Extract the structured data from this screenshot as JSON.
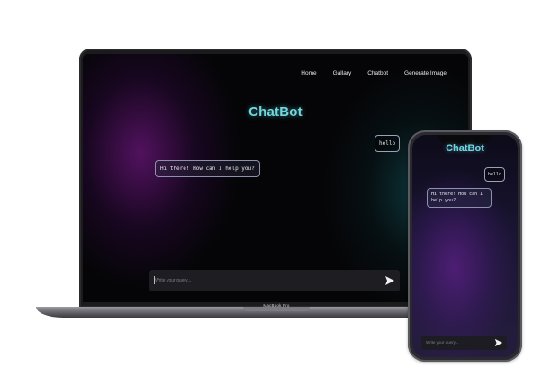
{
  "nav": {
    "items": [
      "Home",
      "Gallary",
      "Chatbot",
      "Generate Image"
    ]
  },
  "chat": {
    "title": "ChatBot",
    "user_message": "hello",
    "bot_message": "Hi there! How can I help you?",
    "input_placeholder": "Write your query..."
  },
  "device": {
    "laptop_label": "MacBook Pro"
  },
  "icons": {
    "send": "send-arrow-icon"
  },
  "colors": {
    "title": "#6fd8e0",
    "bubble_border": "#9aa0b5"
  }
}
